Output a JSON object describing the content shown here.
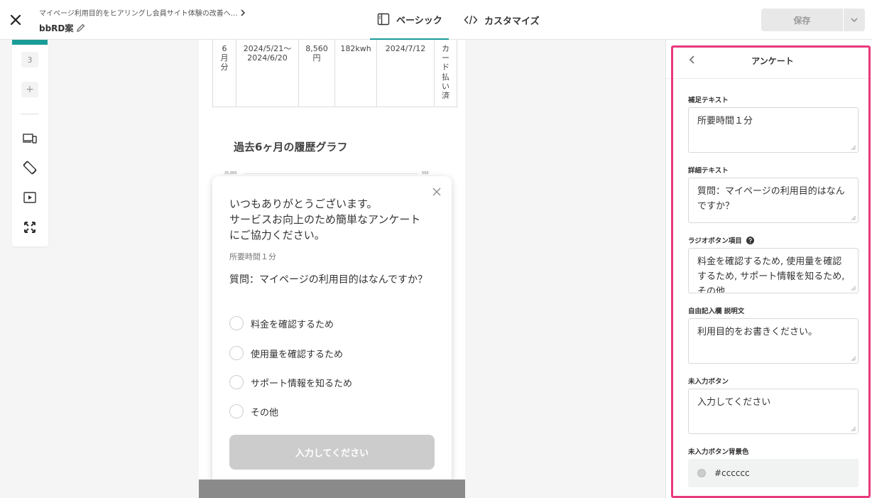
{
  "header": {
    "breadcrumb": "マイページ利用目的をヒアリングし会員サイト体験の改善へ…",
    "project_name": "bbRD案",
    "tabs": [
      {
        "label": "ベーシック",
        "active": true
      },
      {
        "label": "カスタマイズ",
        "active": false
      }
    ],
    "save_label": "保存"
  },
  "rail": {
    "page_number": "3",
    "add_label": "+"
  },
  "preview": {
    "table_row": [
      "6\n月\n分",
      "2024/5/21〜\n2024/6/20",
      "8,560\n円",
      "182kwh",
      "2024/7/12",
      "カ\nー\nド\n払\nい\n済"
    ],
    "graph_title": "過去6ヶ月の履歴グラフ",
    "graph_axis_left": "25,000",
    "graph_axis_right": "500"
  },
  "survey": {
    "title": "いつもありがとうございます。\nサービスお向上のため簡単なアンケート\nにご協力ください。",
    "subtext": "所要時間１分",
    "question": "質問：マイページの利用目的はなんですか？",
    "options": [
      "料金を確認するため",
      "使用量を確認するため",
      "サポート情報を知るため",
      "その他"
    ],
    "submit_label": "入力してください"
  },
  "panel": {
    "title": "アンケート",
    "fields": [
      {
        "label": "補足テキスト",
        "value": "所要時間１分"
      },
      {
        "label": "詳細テキスト",
        "value": "質問：マイページの利用目的はなんですか？"
      },
      {
        "label": "ラジオボタン項目",
        "value": "料金を確認するため, 使用量を確認するため, サポート情報を知るため, その他"
      },
      {
        "label": "自由記入欄 説明文",
        "value": "利用目的をお書きください。"
      },
      {
        "label": "未入力ボタン",
        "value": "入力してください"
      },
      {
        "label": "未入力ボタン背景色",
        "value": "#cccccc"
      }
    ]
  },
  "colors": {
    "accent": "#1a9c96",
    "highlight_frame": "#e8397d",
    "button_disabled": "#cccccc"
  }
}
